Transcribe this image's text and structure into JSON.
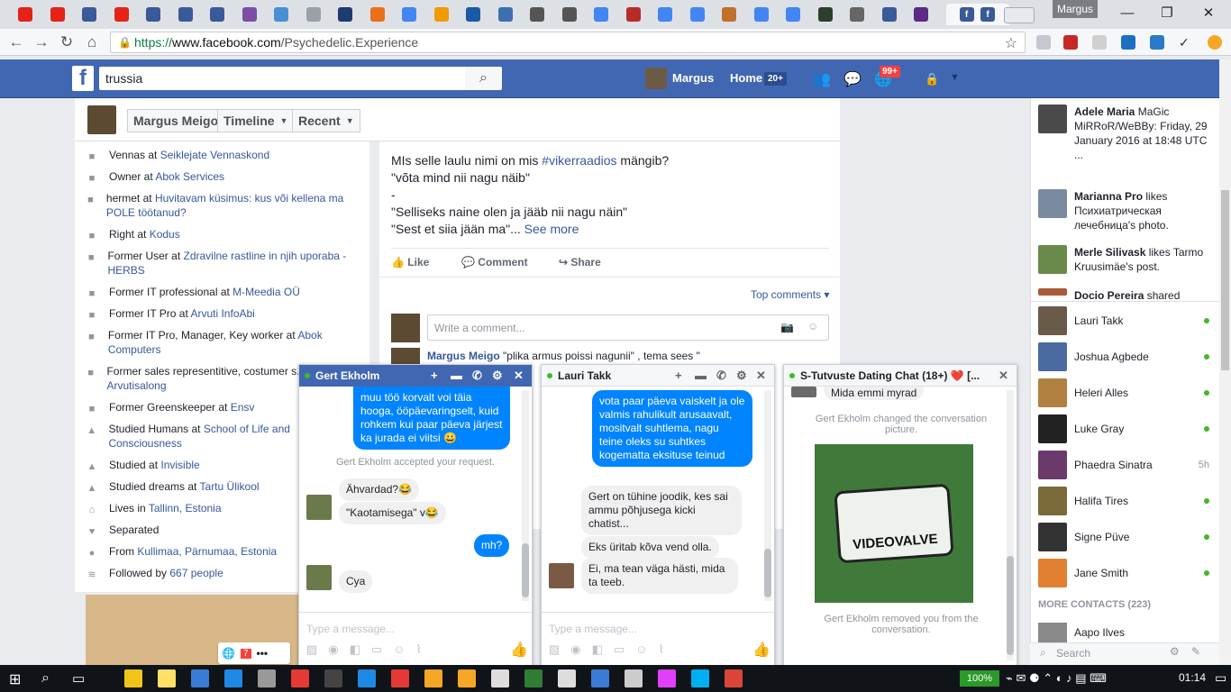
{
  "browser": {
    "profile": "Margus",
    "url_prefix": "https://",
    "url_host": "www.facebook.com",
    "url_path": "/Psychedelic.Experience",
    "tabs": [
      {
        "icon": "youtube-icon",
        "color": "#e62117"
      },
      {
        "icon": "youtube-icon",
        "color": "#e62117"
      },
      {
        "icon": "facebook-icon",
        "color": "#3b5998"
      },
      {
        "icon": "youtube-icon",
        "color": "#e62117"
      },
      {
        "icon": "facebook-icon",
        "color": "#3b5998"
      },
      {
        "icon": "facebook-icon",
        "color": "#3b5998"
      },
      {
        "icon": "facebook-icon",
        "color": "#3b5998"
      },
      {
        "icon": "mail-icon",
        "color": "#7b4fa3"
      },
      {
        "icon": "edge-icon",
        "color": "#4a8fd6"
      },
      {
        "icon": "document-icon",
        "color": "#9aa0a6"
      },
      {
        "icon": "f-icon",
        "color": "#1f3a70"
      },
      {
        "icon": "bookmark-icon",
        "color": "#e8711a"
      },
      {
        "icon": "google-icon",
        "color": "#4285f4"
      },
      {
        "icon": "headphones-icon",
        "color": "#f29900"
      },
      {
        "icon": "h-icon",
        "color": "#1a5aa8"
      },
      {
        "icon": "badge-icon",
        "color": "#3e6fb0"
      },
      {
        "icon": "wikipedia-icon",
        "color": "#555555"
      },
      {
        "icon": "wikipedia-icon",
        "color": "#555555"
      },
      {
        "icon": "google-icon",
        "color": "#4285f4"
      },
      {
        "icon": "q-icon",
        "color": "#b92b27"
      },
      {
        "icon": "google-icon",
        "color": "#4285f4"
      },
      {
        "icon": "google-icon",
        "color": "#4285f4"
      },
      {
        "icon": "mushroom-icon",
        "color": "#c0702a"
      },
      {
        "icon": "google-icon",
        "color": "#4285f4"
      },
      {
        "icon": "google-icon",
        "color": "#4285f4"
      },
      {
        "icon": "game-icon",
        "color": "#2c3e2d"
      },
      {
        "icon": "speaker-icon",
        "color": "#666666"
      },
      {
        "icon": "facebook-icon",
        "color": "#3b5998"
      },
      {
        "icon": "c-icon",
        "color": "#5b2a86"
      }
    ],
    "active_tab_icon": "facebook-icon",
    "tab_close_glyph": "✕"
  },
  "fb": {
    "logo": "f",
    "search_value": "trussia",
    "user_name": "Margus",
    "home_label": "Home",
    "home_count": "20+",
    "notif_count": "99+"
  },
  "timeline": {
    "name_btn": "Margus Meigo",
    "timeline_btn": "Timeline",
    "recent_btn": "Recent"
  },
  "intro": [
    {
      "icon": "briefcase-icon",
      "pre": "Vennas at ",
      "link": "Seiklejate Vennaskond"
    },
    {
      "icon": "briefcase-icon",
      "pre": "Owner at ",
      "link": "Abok Services"
    },
    {
      "icon": "briefcase-icon",
      "pre": "hermet at ",
      "link": "Huvitavam küsimus: kus või kellena ma POLE töötanud?"
    },
    {
      "icon": "briefcase-icon",
      "pre": "Right at ",
      "link": "Kodus"
    },
    {
      "icon": "briefcase-icon",
      "pre": "Former User at ",
      "link": "Zdravilne rastline in njih uporaba - HERBS"
    },
    {
      "icon": "briefcase-icon",
      "pre": "Former IT professional at ",
      "link": "M-Meedia OÜ"
    },
    {
      "icon": "briefcase-icon",
      "pre": "Former IT Pro at ",
      "link": "Arvuti InfoAbi"
    },
    {
      "icon": "briefcase-icon",
      "pre": "Former IT Pro, Manager, Key worker at ",
      "link": "Abok Computers"
    },
    {
      "icon": "briefcase-icon",
      "pre": "Former sales representitive, costumer s... at ",
      "link": "Rover Arvutisalong"
    },
    {
      "icon": "briefcase-icon",
      "pre": "Former Greenskeeper at ",
      "link": "Ensv"
    },
    {
      "icon": "graduation-icon",
      "pre": "Studied Humans at ",
      "link": "School of Life and Consciousness"
    },
    {
      "icon": "graduation-icon",
      "pre": "Studied at ",
      "link": "Invisible"
    },
    {
      "icon": "graduation-icon",
      "pre": "Studied dreams at ",
      "link": "Tartu Ülikool"
    },
    {
      "icon": "home-icon",
      "pre": "Lives in ",
      "link": "Tallinn, Estonia"
    },
    {
      "icon": "heart-icon",
      "pre": "Separated",
      "link": ""
    },
    {
      "icon": "pin-icon",
      "pre": "From ",
      "link": "Kullimaa, Pärnumaa, Estonia"
    },
    {
      "icon": "rss-icon",
      "pre": "Followed by ",
      "link": "667 people"
    }
  ],
  "post": {
    "line1_pre": "MIs selle laulu nimi on mis ",
    "line1_tag": "#vikerraadios",
    "line1_post": " mängib?",
    "line2": "\"võta mind nii nagu näib\"",
    "line3": "-",
    "line4": "\"Selliseks naine olen ja jääb nii nagu näin\"",
    "line5": "\"Sest et siia jään ma\"...",
    "see_more": "See more",
    "like": "Like",
    "comment": "Comment",
    "share": "Share",
    "top_comments": "Top comments ▾",
    "write_comment": "Write a comment...",
    "comment_author": "Margus Meigo",
    "comment_text": "\"plika armus poissi nagunii\" , tema sees \""
  },
  "chats": {
    "gert": {
      "title": "Gert Ekholm",
      "msg_me1": "muu töö korvalt voi täia hooga, ööpäevaringselt, kuid rohkem kui paar päeva järjest ka jurada ei viitsi 😀",
      "sys": "Gert Ekholm accepted your request.",
      "them1": "Ähvardad?😂",
      "them2": "\"Kaotamisega\" v😂",
      "me2": "mh?",
      "them3": "Cya",
      "placeholder": "Type a message..."
    },
    "lauri": {
      "title": "Lauri Takk",
      "me1": "vota paar päeva vaiskelt ja ole valmis rahulikult arusaavalt, mositvalt suhtlema, nagu teine oleks su suhtkes kogematta eksituse teinud",
      "them1": "Gert on tühine joodik, kes sai ammu põhjusega kicki chatist...",
      "them2": "Eks üritab kõva vend olla.",
      "them3": "Ei, ma tean väga hästi, mida ta teeb.",
      "placeholder": "Type a message..."
    },
    "group": {
      "title": "S-Tutvuste Dating Chat (18+) ❤️ [...",
      "top_msg": "Mida emmi myrad",
      "sys1": "Gert Ekholm changed the conversation picture.",
      "sign": "VIDEOVALVE",
      "sys2": "Gert Ekholm removed you from the conversation."
    }
  },
  "ticker": [
    {
      "bold": "Adele Maria",
      "text": " MaGic MiRRoR/WeBBy: Friday, 29 January 2016 at 18:48 UTC ..."
    },
    {
      "bold": "Marianna Pro",
      "text": " likes Психиатрическая лечебница's photo."
    },
    {
      "bold": "Merle Silivask",
      "text": " likes Tarmo Kruusimäe's post."
    },
    {
      "bold": "Docio Pereira",
      "text": " shared"
    }
  ],
  "contacts": [
    {
      "name": "Lauri Takk",
      "status": "online",
      "color": "#6a5a4a"
    },
    {
      "name": "Joshua Agbede",
      "status": "online",
      "color": "#4a6aa0"
    },
    {
      "name": "Heleri Alles",
      "status": "online",
      "color": "#b08040"
    },
    {
      "name": "Luke Gray",
      "status": "online",
      "color": "#222222"
    },
    {
      "name": "Phaedra Sinatra",
      "status": "5h",
      "color": "#6a3a6a"
    },
    {
      "name": "Halifa Tires",
      "status": "online",
      "color": "#7a6a3a"
    },
    {
      "name": "Signe Püve",
      "status": "online",
      "color": "#333333"
    },
    {
      "name": "Jane Smith",
      "status": "online",
      "color": "#e08030"
    }
  ],
  "more_contacts": "MORE CONTACTS (223)",
  "aapo": "Aapo Ilves",
  "sidebar_search": "Search",
  "taskbar": {
    "battery": "100%",
    "time": "01:14"
  }
}
